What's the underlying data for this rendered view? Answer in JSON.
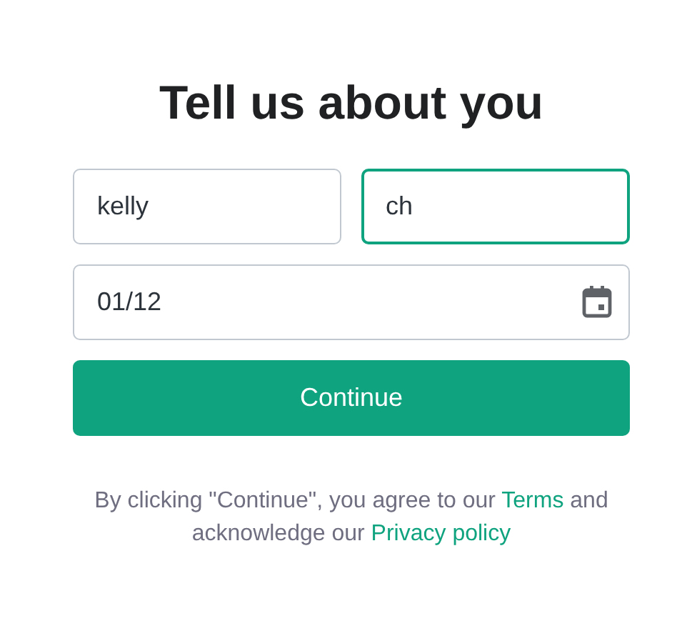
{
  "title": "Tell us about you",
  "fields": [
    {
      "kind": "text",
      "value": "kelly",
      "focused": false
    },
    {
      "kind": "text",
      "value": "ch",
      "focused": true
    },
    {
      "kind": "date",
      "value": "01/12",
      "focused": false
    }
  ],
  "button": {
    "label": "Continue"
  },
  "legal": [
    {
      "kind": "text",
      "text": "By clicking \"Continue\", you agree to our "
    },
    {
      "kind": "link",
      "text": "Terms"
    },
    {
      "kind": "text",
      "text": " and acknowledge our "
    },
    {
      "kind": "link",
      "text": "Privacy policy"
    }
  ]
}
